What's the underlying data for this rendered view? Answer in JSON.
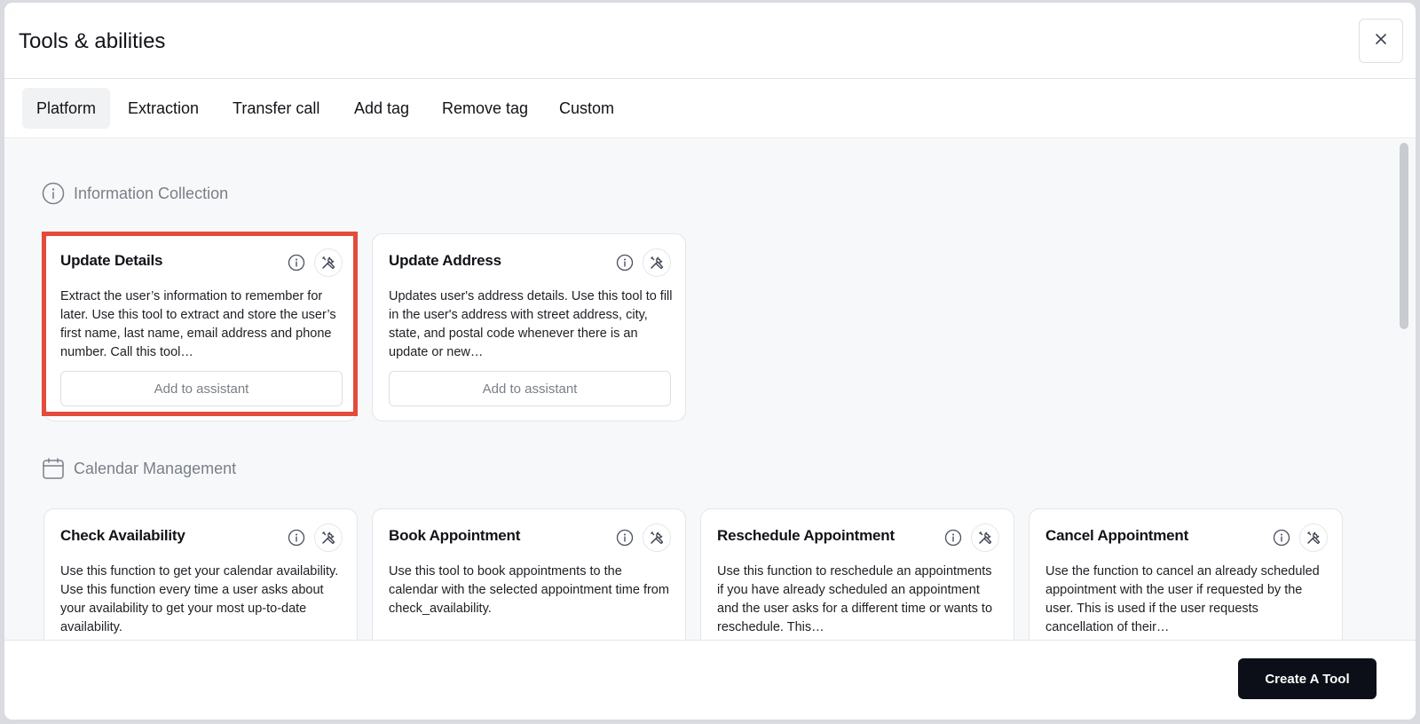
{
  "dialog": {
    "title": "Tools & abilities"
  },
  "tabs": [
    {
      "label": "Platform",
      "active": true
    },
    {
      "label": "Extraction"
    },
    {
      "label": "Transfer call"
    },
    {
      "label": "Add tag"
    },
    {
      "label": "Remove tag"
    },
    {
      "label": "Custom"
    }
  ],
  "sections": [
    {
      "title": "Information Collection",
      "icon": "info-circle-icon",
      "cards": [
        {
          "title": "Update Details",
          "description": "Extract the user’s information to remember for later. Use this tool to extract and store the user’s first name, last name, email address and phone number. Call this tool…",
          "button": "Add to assistant"
        },
        {
          "title": "Update Address",
          "description": "Updates user's address details. Use this tool to fill in the user's address with street address, city, state, and postal code whenever there is an update or new…",
          "button": "Add to assistant"
        }
      ]
    },
    {
      "title": "Calendar Management",
      "icon": "calendar-icon",
      "cards": [
        {
          "title": "Check Availability",
          "description": "Use this function to get your calendar availability. Use this function every time a user asks about your availability to get your most up-to-date availability."
        },
        {
          "title": "Book Appointment",
          "description": "Use this tool to book appointments to the calendar with the selected appointment time from check_availability."
        },
        {
          "title": "Reschedule Appointment",
          "description": "Use this function to reschedule an appointments if you have already scheduled an appointment and the user asks for a different time or wants to reschedule. This…"
        },
        {
          "title": "Cancel Appointment",
          "description": "Use the function to cancel an already scheduled appointment with the user if requested by the user. This is used if the user requests cancellation of their…"
        }
      ]
    }
  ],
  "footer": {
    "create_label": "Create A Tool"
  },
  "colors": {
    "highlight": "#e34b3b",
    "primary_button": "#0c0f17"
  }
}
